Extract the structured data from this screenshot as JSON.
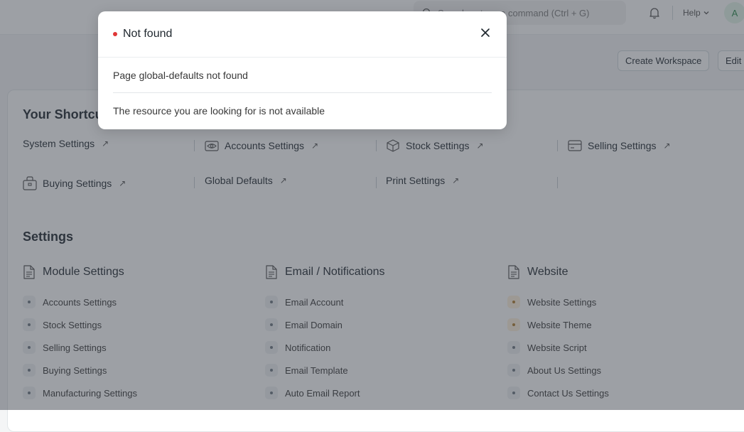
{
  "navbar": {
    "search_placeholder": "Search or type a command (Ctrl + G)",
    "help_label": "Help",
    "avatar_initial": "A"
  },
  "toolbar": {
    "create_workspace_label": "Create Workspace",
    "edit_label": "Edit"
  },
  "shortcuts": {
    "title": "Your Shortcuts",
    "items": [
      {
        "label": "System Settings",
        "icon": "none"
      },
      {
        "label": "Accounts Settings",
        "icon": "eye-icon"
      },
      {
        "label": "Stock Settings",
        "icon": "box-icon"
      },
      {
        "label": "Selling Settings",
        "icon": "card-icon"
      },
      {
        "label": "Buying Settings",
        "icon": "bag-icon"
      },
      {
        "label": "Global Defaults",
        "icon": "none"
      },
      {
        "label": "Print Settings",
        "icon": "none"
      }
    ],
    "arrow": "↗"
  },
  "settings": {
    "title": "Settings",
    "columns": [
      {
        "title": "Module Settings",
        "links": [
          "Accounts Settings",
          "Stock Settings",
          "Selling Settings",
          "Buying Settings",
          "Manufacturing Settings"
        ]
      },
      {
        "title": "Email / Notifications",
        "links": [
          "Email Account",
          "Email Domain",
          "Notification",
          "Email Template",
          "Auto Email Report"
        ]
      },
      {
        "title": "Website",
        "links": [
          "Website Settings",
          "Website Theme",
          "Website Script",
          "About Us Settings",
          "Contact Us Settings"
        ]
      }
    ]
  },
  "modal": {
    "title": "Not found",
    "message": "Page global-defaults not found",
    "detail": "The resource you are looking for is not available",
    "status_color": "#e03636"
  }
}
